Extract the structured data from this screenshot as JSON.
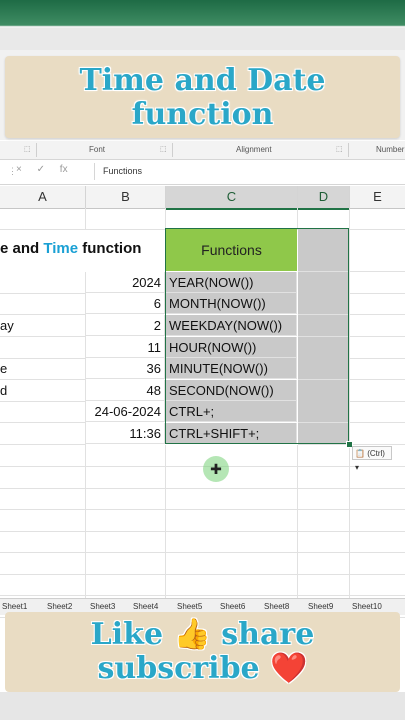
{
  "banner": {
    "title_line1": "Time and Date",
    "title_line2": "function"
  },
  "ribbon": {
    "groups": [
      "Font",
      "Alignment",
      "Number"
    ]
  },
  "formula_bar": {
    "icons": [
      "×",
      "✓",
      "fx"
    ],
    "value": "Functions"
  },
  "columns": [
    "A",
    "B",
    "C",
    "D",
    "E"
  ],
  "sheet_title": {
    "part1": "e and ",
    "part2": "Time",
    "part3": " function"
  },
  "header_cell": "Functions",
  "rows": [
    {
      "a": "",
      "b": "2024",
      "c": "YEAR(NOW())"
    },
    {
      "a": "",
      "b": "6",
      "c": "MONTH(NOW())"
    },
    {
      "a": "ay",
      "b": "2",
      "c": "WEEKDAY(NOW())"
    },
    {
      "a": "",
      "b": "11",
      "c": "HOUR(NOW())"
    },
    {
      "a": "e",
      "b": "36",
      "c": "MINUTE(NOW())"
    },
    {
      "a": "d",
      "b": "48",
      "c": "SECOND(NOW())"
    },
    {
      "a": "",
      "b": "24-06-2024",
      "c": "CTRL+;"
    },
    {
      "a": "",
      "b": "11:36",
      "c": "CTRL+SHIFT+;"
    }
  ],
  "paste_options": "(Ctrl)",
  "sheets": [
    "Sheet1",
    "Sheet2",
    "Sheet3",
    "Sheet4",
    "Sheet5",
    "Sheet6",
    "Sheet8",
    "Sheet9",
    "Sheet10"
  ],
  "bottom_banner": {
    "line1": "Like 👍 share",
    "line2": "subscribe ❤️"
  },
  "colors": {
    "accent": "#217346",
    "header_green": "#8fc84a",
    "banner_bg": "#e9dcc3",
    "banner_text": "#2aa7c8"
  }
}
